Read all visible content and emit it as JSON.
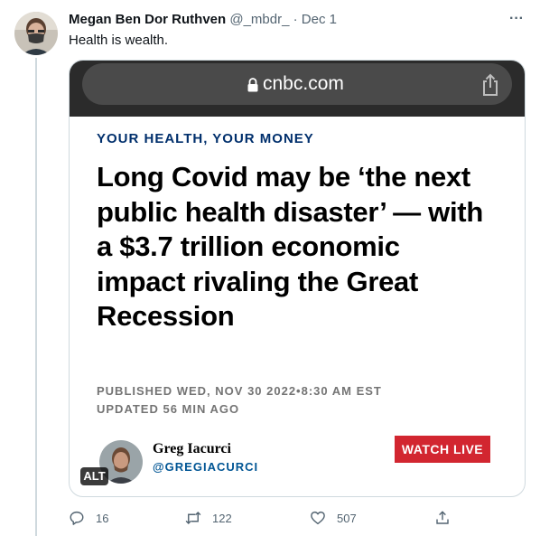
{
  "tweet": {
    "author_name": "Megan Ben Dor Ruthven",
    "author_handle": "@_mbdr_",
    "separator": "·",
    "time": "Dec 1",
    "more_label": "···",
    "text": "Health is wealth.",
    "avatar_icon": "avatar-with-mask"
  },
  "media": {
    "browser": {
      "url": "cnbc.com",
      "lock_icon": "lock-icon",
      "share_icon": "share-icon"
    },
    "article": {
      "category": "YOUR HEALTH, YOUR MONEY",
      "headline": "Long Covid may be ‘the next public health disaster’ — with a $3.7 trillion economic impact rivaling the Great Recession",
      "published": "PUBLISHED WED, NOV 30 2022•8:30 AM EST",
      "updated": "UPDATED 56 MIN AGO",
      "author_name": "Greg Iacurci",
      "author_handle": "@GREGIACURCI",
      "watch_live": "WATCH LIVE"
    },
    "alt_badge": "ALT"
  },
  "actions": {
    "reply_count": "16",
    "retweet_count": "122",
    "like_count": "507"
  },
  "colors": {
    "category": "#002f6c",
    "watch_live": "#d22630",
    "author_handle": "#005594",
    "muted": "#536471"
  }
}
